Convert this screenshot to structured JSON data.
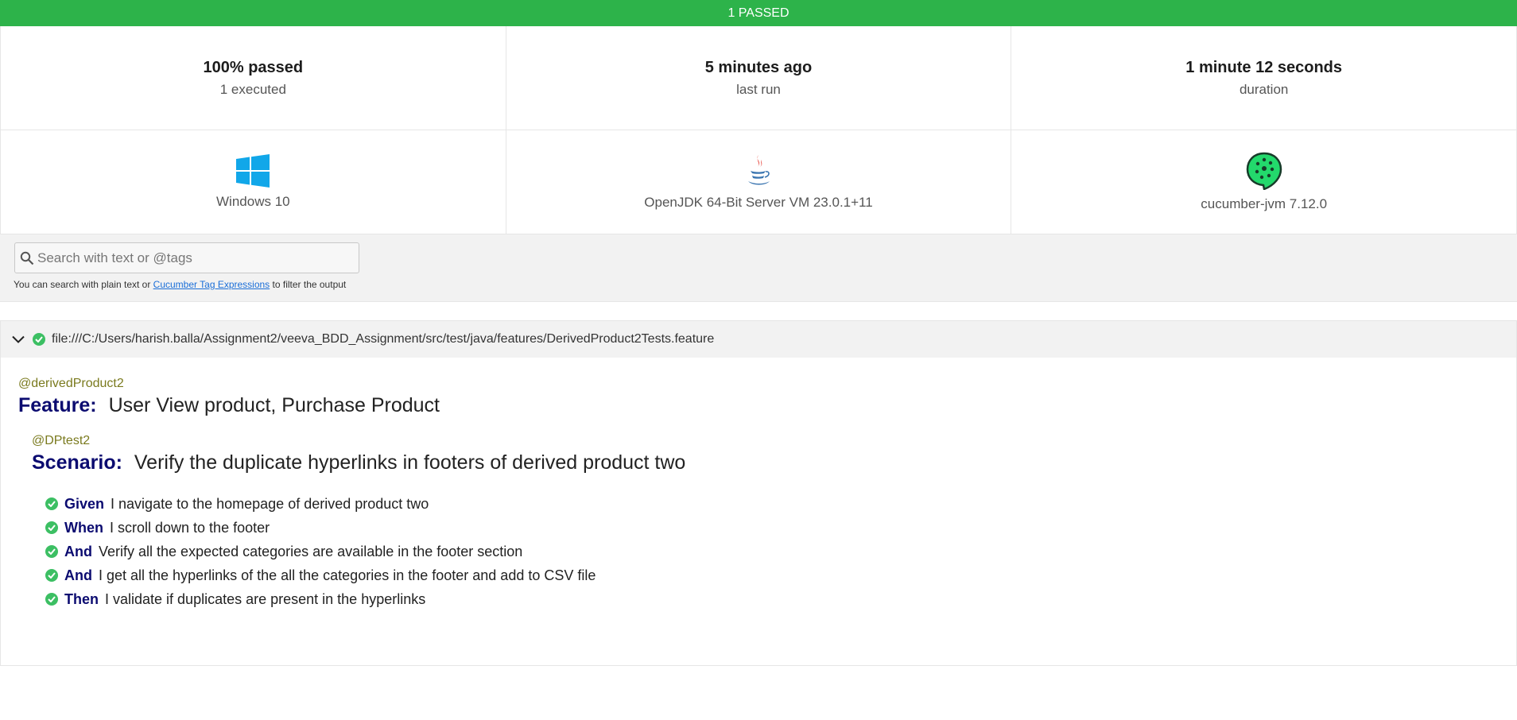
{
  "banner": {
    "text": "1 PASSED"
  },
  "summary": [
    {
      "big": "100% passed",
      "small": "1 executed"
    },
    {
      "big": "5 minutes ago",
      "small": "last run"
    },
    {
      "big": "1 minute 12 seconds",
      "small": "duration"
    }
  ],
  "environment": [
    {
      "icon": "windows-logo-icon",
      "label": "Windows 10"
    },
    {
      "icon": "java-logo-icon",
      "label": "OpenJDK 64-Bit Server VM 23.0.1+11"
    },
    {
      "icon": "cucumber-logo-icon",
      "label": "cucumber-jvm 7.12.0"
    }
  ],
  "search": {
    "placeholder": "Search with text or @tags",
    "hint_prefix": "You can search with plain text or ",
    "hint_link": "Cucumber Tag Expressions",
    "hint_suffix": " to filter the output"
  },
  "feature": {
    "path": "file:///C:/Users/harish.balla/Assignment2/veeva_BDD_Assignment/src/test/java/features/DerivedProduct2Tests.feature",
    "tag": "@derivedProduct2",
    "keyword": "Feature:",
    "name": "User View product, Purchase Product",
    "scenario": {
      "tag": "@DPtest2",
      "keyword": "Scenario:",
      "name": "Verify the duplicate hyperlinks in footers of derived product two",
      "steps": [
        {
          "keyword": "Given",
          "text": "I navigate to the homepage of derived product two",
          "status": "passed"
        },
        {
          "keyword": "When",
          "text": "I scroll down to the footer",
          "status": "passed"
        },
        {
          "keyword": "And",
          "text": "Verify all the expected categories are available in the footer section",
          "status": "passed"
        },
        {
          "keyword": "And",
          "text": "I get all the hyperlinks of the all the categories in the footer and add to CSV file",
          "status": "passed"
        },
        {
          "keyword": "Then",
          "text": "I validate if duplicates are present in the hyperlinks",
          "status": "passed"
        }
      ]
    }
  },
  "colors": {
    "passed": "#2db34a",
    "keyword": "#0b0b70",
    "tag": "#7a7a1e",
    "link": "#1a6ed8"
  }
}
